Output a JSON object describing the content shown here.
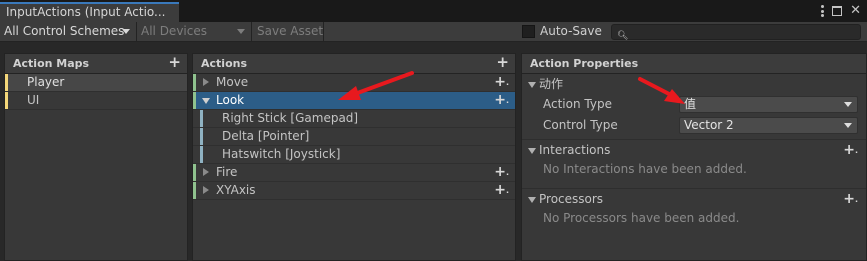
{
  "window": {
    "tab_title": "InputActions (Input Actio..."
  },
  "toolbar": {
    "control_schemes": "All Control Schemes",
    "devices": "All Devices",
    "save_asset": "Save Asset",
    "auto_save": "Auto-Save",
    "search_placeholder": ""
  },
  "action_maps": {
    "header": "Action Maps",
    "items": [
      {
        "label": "Player",
        "selected": true
      },
      {
        "label": "UI",
        "selected": false
      }
    ]
  },
  "actions": {
    "header": "Actions",
    "items": [
      {
        "label": "Move"
      },
      {
        "label": "Look"
      },
      {
        "label": "Right Stick [Gamepad]"
      },
      {
        "label": "Delta [Pointer]"
      },
      {
        "label": "Hatswitch [Joystick]"
      },
      {
        "label": "Fire"
      },
      {
        "label": "XYAxis"
      }
    ]
  },
  "properties": {
    "header": "Action Properties",
    "action_section": "动作",
    "action_type_label": "Action Type",
    "action_type_value": "值",
    "control_type_label": "Control Type",
    "control_type_value": "Vector 2",
    "interactions_header": "Interactions",
    "interactions_empty": "No Interactions have been added.",
    "processors_header": "Processors",
    "processors_empty": "No Processors have been added."
  },
  "colors": {
    "action_map_marker": "#f4d77a",
    "action_marker": "#8fc28e",
    "binding_marker": "#8fb2c2",
    "selection": "#2c5d87",
    "annotation_arrow": "#e8191e"
  }
}
